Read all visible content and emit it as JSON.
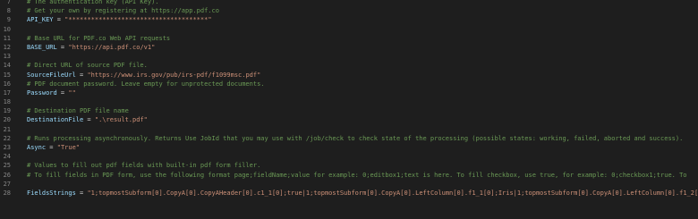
{
  "lines": [
    {
      "n": "7",
      "kind": "comment",
      "text": "# The authentication key (API Key)."
    },
    {
      "n": "8",
      "kind": "comment",
      "text": "# Get your own by registering at https://app.pdf.co"
    },
    {
      "n": "9",
      "kind": "assign",
      "var": "API_KEY",
      "op": " = ",
      "value": "\"*************************************\""
    },
    {
      "n": "10",
      "kind": "blank"
    },
    {
      "n": "11",
      "kind": "comment",
      "text": "# Base URL for PDF.co Web API requests"
    },
    {
      "n": "12",
      "kind": "assign",
      "var": "BASE_URL",
      "op": " = ",
      "value": "\"https://api.pdf.co/v1\""
    },
    {
      "n": "13",
      "kind": "blank"
    },
    {
      "n": "14",
      "kind": "comment",
      "text": "# Direct URL of source PDF file."
    },
    {
      "n": "15",
      "kind": "assign",
      "var": "SourceFileUrl",
      "op": " = ",
      "value": "\"https://www.irs.gov/pub/irs-pdf/f1099msc.pdf\""
    },
    {
      "n": "16",
      "kind": "comment",
      "text": "# PDF document password. Leave empty for unprotected documents."
    },
    {
      "n": "17",
      "kind": "assign",
      "var": "Password",
      "op": " = ",
      "value": "\"\""
    },
    {
      "n": "18",
      "kind": "blank"
    },
    {
      "n": "19",
      "kind": "comment",
      "text": "# Destination PDF file name"
    },
    {
      "n": "20",
      "kind": "assign",
      "var": "DestinationFile",
      "op": " = ",
      "value": "\".\\result.pdf\""
    },
    {
      "n": "21",
      "kind": "blank"
    },
    {
      "n": "22",
      "kind": "comment",
      "text": "# Runs processing asynchronously. Returns Use JobId that you may use with /job/check to check state of the processing (possible states: working, failed, aborted and success)."
    },
    {
      "n": "23",
      "kind": "assign",
      "var": "Async",
      "op": " = ",
      "value": "\"True\""
    },
    {
      "n": "24",
      "kind": "blank"
    },
    {
      "n": "25",
      "kind": "comment",
      "text": "# Values to fill out pdf fields with built-in pdf form filler."
    },
    {
      "n": "26",
      "kind": "comment",
      "text": "# To fill fields in PDF form, use the following format page;fieldName;value for example: 0;editbox1;text is here. To fill checkbox, use true, for example: 0;checkbox1;true. To"
    },
    {
      "n": "27",
      "kind": "blank"
    },
    {
      "n": "28",
      "kind": "assign",
      "var": "FieldsStrings",
      "op": " = ",
      "value": "\"1;topmostSubform[0].CopyA[0].CopyAHeader[0].c1_1[0];true|1;topmostSubform[0].CopyA[0].LeftColumn[0].f1_1[0];Iris|1;topmostSubform[0].CopyA[0].LeftColumn[0].f1_2[0]"
    }
  ],
  "colors": {
    "background": "#1e1e1e",
    "line_number": "#858585",
    "comment": "#6a9955",
    "variable": "#9cdcfe",
    "operator": "#d4d4d4",
    "string": "#ce9178"
  }
}
